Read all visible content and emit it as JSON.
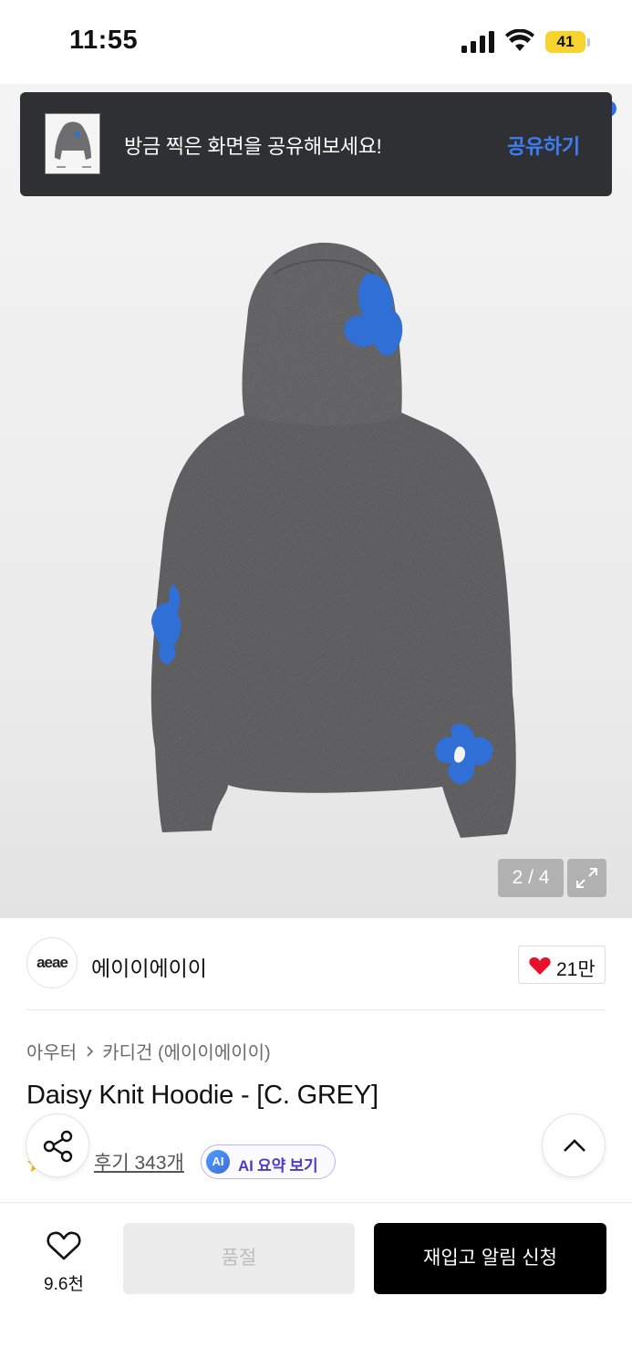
{
  "status_bar": {
    "time": "11:55",
    "battery": "41",
    "battery_color": "#f7d330"
  },
  "toast": {
    "message": "방금 찍은 화면을 공유해보세요!",
    "action_label": "공유하기",
    "action_color": "#3d7ef5",
    "thumbnail_icon": "hoodie-thumbnail"
  },
  "product_image": {
    "counter": "2 / 4",
    "expand_icon": "expand-icon",
    "sweater_color": "#6e6e70",
    "flower_color": "#2f6fd6"
  },
  "brand": {
    "logo_text": "aeae",
    "name": "에이이에이이",
    "like_count": "21만",
    "like_color": "#e8112d"
  },
  "breadcrumb": {
    "category": "아우터",
    "subcategory": "카디건 (에이이에이이)"
  },
  "product": {
    "title": "Daisy Knit Hoodie - [C. GREY]",
    "review_link": "후기 343개",
    "ai_badge": "AI",
    "ai_summary": "AI 요약 보기"
  },
  "floating": {
    "share_icon": "share-icon",
    "scroll_top_icon": "chevron-up-icon"
  },
  "bottom_bar": {
    "wish_count": "9.6천",
    "soldout_label": "품절",
    "restock_label": "재입고 알림 신청"
  }
}
